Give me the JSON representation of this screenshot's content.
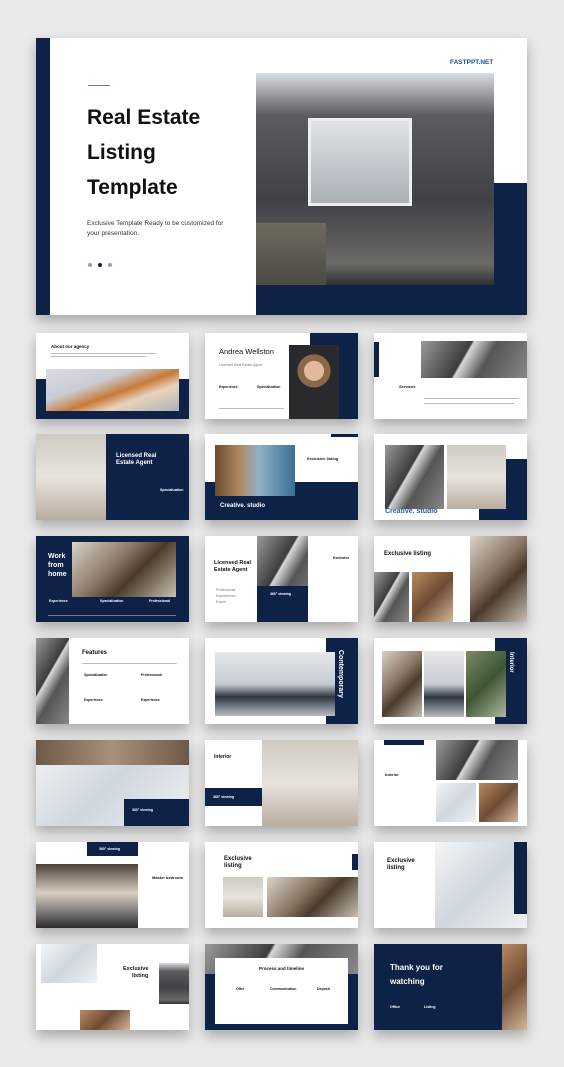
{
  "hero": {
    "brand": "FASTPPT.NET",
    "title_lines": [
      "Real Estate",
      "Listing",
      "Template"
    ],
    "subtitle": "Exclusive Template Ready to be customized for your presentation."
  },
  "slides": {
    "about": {
      "title": "About our agency"
    },
    "agent": {
      "name": "Andrea Wellston",
      "role": "Licensed Real Estate Agent",
      "col1": "Experience",
      "col2": "Specialization"
    },
    "services": {
      "title": "Services"
    },
    "licensed": {
      "title_lines": [
        "Licensed Real",
        "Estate Agent"
      ],
      "label": "Specialization"
    },
    "creative1": {
      "heading": "Exclusive listing",
      "title": "Creative. studio"
    },
    "creative2": {
      "title": "Creative. studio"
    },
    "work": {
      "title_lines": [
        "Work",
        "from",
        "home"
      ],
      "cols": [
        "Experience",
        "Specialization",
        "Professional"
      ]
    },
    "licensed2": {
      "title_lines": [
        "Licensed Real",
        "Estate Agent"
      ],
      "bullets": [
        "Professional",
        "Experienced",
        "Expert"
      ],
      "badge": "360° viewing",
      "side": "Exclusive"
    },
    "exclusive1": {
      "title": "Exclusive listing"
    },
    "features": {
      "title": "Features",
      "items": [
        "Specialization",
        "Professional",
        "Experience",
        "Experience"
      ]
    },
    "contemporary": {
      "title": "Contemporary"
    },
    "interior_v": {
      "title": "Interior"
    },
    "viewing": {
      "title": "360° viewing"
    },
    "interior2": {
      "title": "Interior",
      "badge": "360° viewing"
    },
    "interior3": {
      "title": "Interior"
    },
    "master": {
      "badge": "360° viewing",
      "title": "Master bedroom"
    },
    "exclusive2": {
      "title_lines": [
        "Exclusive",
        "listing"
      ]
    },
    "exclusive3": {
      "title_lines": [
        "Exclusive",
        "listing"
      ]
    },
    "exclusive4": {
      "title_lines": [
        "Exclusive",
        "listing"
      ]
    },
    "process": {
      "title": "Process and timeline",
      "cols": [
        "Offer",
        "Communication",
        "Deposit"
      ]
    },
    "thanks": {
      "title_lines": [
        "Thank you for",
        "watching"
      ],
      "cols": [
        "Office",
        "Listing"
      ]
    }
  }
}
